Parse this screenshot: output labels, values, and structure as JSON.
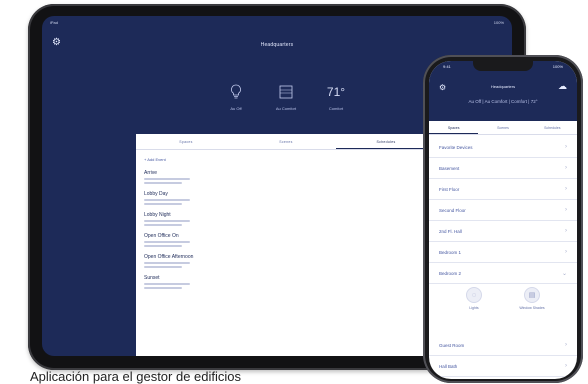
{
  "caption": "Aplicación para el gestor de edificios",
  "tablet": {
    "status_left": "iPad",
    "status_right": "100%",
    "title": "Headquarters",
    "controls": [
      {
        "icon": "lightbulb-icon",
        "label": "Au Off"
      },
      {
        "icon": "window-shade-icon",
        "label": "Au Comfort"
      },
      {
        "value": "71°",
        "label": "Comfort"
      }
    ],
    "tabs": [
      "Spaces",
      "Scenes",
      "Schedules"
    ],
    "add_label": "+ Add Event",
    "events": [
      {
        "name": "Arrive"
      },
      {
        "name": "Lobby Day"
      },
      {
        "name": "Lobby Night"
      },
      {
        "name": "Open Office On"
      },
      {
        "name": "Open Office Afternoon"
      },
      {
        "name": "Sunset"
      }
    ]
  },
  "phone": {
    "status_left": "9:41",
    "status_right": "100%",
    "title": "Headquarters",
    "subtitle": "Au Off | Au Comfort | Comfort | 72°",
    "tabs": [
      "Spaces",
      "Scenes",
      "Schedules"
    ],
    "items": [
      {
        "label": "Favorite Devices"
      },
      {
        "label": "Basement"
      },
      {
        "label": "First Floor"
      },
      {
        "label": "Second Floor"
      },
      {
        "label": "2nd Fl. Hall"
      },
      {
        "label": "Bedroom 1"
      },
      {
        "label": "Bedroom 2"
      }
    ],
    "scenes": [
      {
        "icon": "lightbulb-icon",
        "label": "Lights"
      },
      {
        "icon": "window-shade-icon",
        "label": "Window Shades"
      }
    ],
    "items2": [
      {
        "label": "Guest Room"
      },
      {
        "label": "Hall Bath"
      }
    ]
  }
}
